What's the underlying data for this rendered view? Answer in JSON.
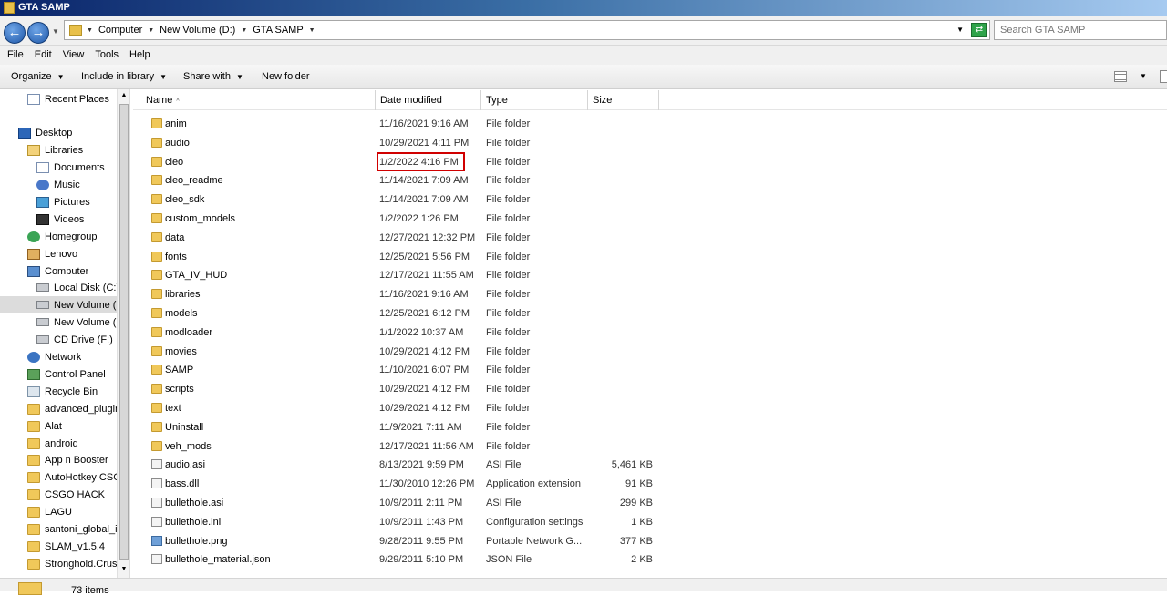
{
  "window": {
    "title": "GTA SAMP"
  },
  "address": {
    "crumbs": [
      "Computer",
      "New Volume (D:)",
      "GTA SAMP"
    ],
    "search_placeholder": "Search GTA SAMP"
  },
  "menu": [
    "File",
    "Edit",
    "View",
    "Tools",
    "Help"
  ],
  "commands": {
    "organize": "Organize",
    "include_in_library": "Include in library",
    "share_with": "Share with",
    "new_folder": "New folder"
  },
  "nav": [
    {
      "label": "Recent Places",
      "icon": "recent-places-icon"
    },
    {
      "label": "Desktop",
      "icon": "desktop-icon"
    },
    {
      "label": "Libraries",
      "icon": "libraries-icon"
    },
    {
      "label": "Documents",
      "icon": "documents-icon"
    },
    {
      "label": "Music",
      "icon": "music-icon"
    },
    {
      "label": "Pictures",
      "icon": "pictures-icon"
    },
    {
      "label": "Videos",
      "icon": "videos-icon"
    },
    {
      "label": "Homegroup",
      "icon": "homegroup-icon"
    },
    {
      "label": "Lenovo",
      "icon": "user-icon"
    },
    {
      "label": "Computer",
      "icon": "computer-icon"
    },
    {
      "label": "Local Disk (C:)",
      "icon": "drive-icon"
    },
    {
      "label": "New Volume (D:)",
      "icon": "drive-icon",
      "selected": true
    },
    {
      "label": "New Volume (E:)",
      "icon": "drive-icon"
    },
    {
      "label": "CD Drive (F:)",
      "icon": "cd-drive-icon"
    },
    {
      "label": "Network",
      "icon": "network-icon"
    },
    {
      "label": "Control Panel",
      "icon": "control-panel-icon"
    },
    {
      "label": "Recycle Bin",
      "icon": "recycle-bin-icon"
    },
    {
      "label": "advanced_plugin",
      "icon": "folder-icon"
    },
    {
      "label": "Alat",
      "icon": "folder-icon"
    },
    {
      "label": "android",
      "icon": "folder-icon"
    },
    {
      "label": "App n Booster",
      "icon": "folder-icon"
    },
    {
      "label": "AutoHotkey CSGO",
      "icon": "folder-icon"
    },
    {
      "label": "CSGO HACK",
      "icon": "folder-icon"
    },
    {
      "label": "LAGU",
      "icon": "folder-icon"
    },
    {
      "label": "santoni_global_i",
      "icon": "folder-icon"
    },
    {
      "label": "SLAM_v1.5.4",
      "icon": "folder-icon"
    },
    {
      "label": "Stronghold.Crus",
      "icon": "folder-icon"
    }
  ],
  "columns": {
    "name": "Name",
    "date": "Date modified",
    "type": "Type",
    "size": "Size"
  },
  "files": [
    {
      "name": "anim",
      "date": "11/16/2021 9:16 AM",
      "type": "File folder",
      "size": "",
      "icon": "folder-icon"
    },
    {
      "name": "audio",
      "date": "10/29/2021 4:11 PM",
      "type": "File folder",
      "size": "",
      "icon": "folder-icon"
    },
    {
      "name": "cleo",
      "date": "1/2/2022 4:16 PM",
      "type": "File folder",
      "size": "",
      "icon": "folder-icon",
      "highlighted": true
    },
    {
      "name": "cleo_readme",
      "date": "11/14/2021 7:09 AM",
      "type": "File folder",
      "size": "",
      "icon": "folder-icon"
    },
    {
      "name": "cleo_sdk",
      "date": "11/14/2021 7:09 AM",
      "type": "File folder",
      "size": "",
      "icon": "folder-icon"
    },
    {
      "name": "custom_models",
      "date": "1/2/2022 1:26 PM",
      "type": "File folder",
      "size": "",
      "icon": "folder-icon"
    },
    {
      "name": "data",
      "date": "12/27/2021 12:32 PM",
      "type": "File folder",
      "size": "",
      "icon": "folder-icon"
    },
    {
      "name": "fonts",
      "date": "12/25/2021 5:56 PM",
      "type": "File folder",
      "size": "",
      "icon": "folder-icon"
    },
    {
      "name": "GTA_IV_HUD",
      "date": "12/17/2021 11:55 AM",
      "type": "File folder",
      "size": "",
      "icon": "folder-icon"
    },
    {
      "name": "libraries",
      "date": "11/16/2021 9:16 AM",
      "type": "File folder",
      "size": "",
      "icon": "folder-icon"
    },
    {
      "name": "models",
      "date": "12/25/2021 6:12 PM",
      "type": "File folder",
      "size": "",
      "icon": "folder-icon"
    },
    {
      "name": "modloader",
      "date": "1/1/2022 10:37 AM",
      "type": "File folder",
      "size": "",
      "icon": "folder-icon"
    },
    {
      "name": "movies",
      "date": "10/29/2021 4:12 PM",
      "type": "File folder",
      "size": "",
      "icon": "folder-icon"
    },
    {
      "name": "SAMP",
      "date": "11/10/2021 6:07 PM",
      "type": "File folder",
      "size": "",
      "icon": "folder-icon"
    },
    {
      "name": "scripts",
      "date": "10/29/2021 4:12 PM",
      "type": "File folder",
      "size": "",
      "icon": "folder-icon"
    },
    {
      "name": "text",
      "date": "10/29/2021 4:12 PM",
      "type": "File folder",
      "size": "",
      "icon": "folder-icon"
    },
    {
      "name": "Uninstall",
      "date": "11/9/2021 7:11 AM",
      "type": "File folder",
      "size": "",
      "icon": "folder-icon"
    },
    {
      "name": "veh_mods",
      "date": "12/17/2021 11:56 AM",
      "type": "File folder",
      "size": "",
      "icon": "folder-icon"
    },
    {
      "name": "audio.asi",
      "date": "8/13/2021 9:59 PM",
      "type": "ASI File",
      "size": "5,461 KB",
      "icon": "file-icon"
    },
    {
      "name": "bass.dll",
      "date": "11/30/2010 12:26 PM",
      "type": "Application extension",
      "size": "91 KB",
      "icon": "dll-file-icon"
    },
    {
      "name": "bullethole.asi",
      "date": "10/9/2011 2:11 PM",
      "type": "ASI File",
      "size": "299 KB",
      "icon": "file-icon"
    },
    {
      "name": "bullethole.ini",
      "date": "10/9/2011 1:43 PM",
      "type": "Configuration settings",
      "size": "1 KB",
      "icon": "config-file-icon"
    },
    {
      "name": "bullethole.png",
      "date": "9/28/2011 9:55 PM",
      "type": "Portable Network G...",
      "size": "377 KB",
      "icon": "image-file-icon"
    },
    {
      "name": "bullethole_material.json",
      "date": "9/29/2011 5:10 PM",
      "type": "JSON File",
      "size": "2 KB",
      "icon": "file-icon"
    }
  ],
  "status": {
    "text": "73 items"
  }
}
